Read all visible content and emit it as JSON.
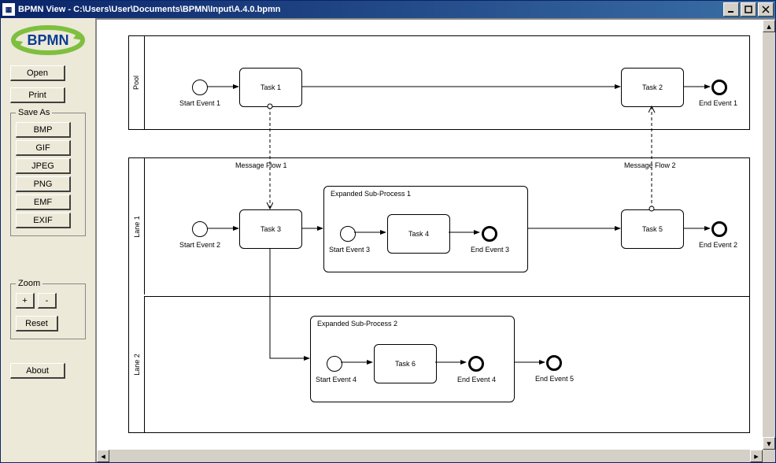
{
  "window": {
    "title": "BPMN View - C:\\Users\\User\\Documents\\BPMN\\Input\\A.4.0.bpmn"
  },
  "sidebar": {
    "open": "Open",
    "print": "Print",
    "save_as_legend": "Save As",
    "bmp": "BMP",
    "gif": "GIF",
    "jpeg": "JPEG",
    "png": "PNG",
    "emf": "EMF",
    "exif": "EXIF",
    "zoom_legend": "Zoom",
    "zoom_in": "+",
    "zoom_out": "-",
    "reset": "Reset",
    "about": "About"
  },
  "diagram": {
    "pool_label": "Pool",
    "lane1_label": "Lane 1",
    "lane2_label": "Lane 2",
    "start_event_1": "Start Event 1",
    "start_event_2": "Start Event 2",
    "start_event_3": "Start Event 3",
    "start_event_4": "Start Event 4",
    "end_event_1": "End Event 1",
    "end_event_2": "End Event 2",
    "end_event_3": "End Event 3",
    "end_event_4": "End Event 4",
    "end_event_5": "End Event 5",
    "task1": "Task 1",
    "task2": "Task 2",
    "task3": "Task 3",
    "task4": "Task 4",
    "task5": "Task 5",
    "task6": "Task 6",
    "subproc1": "Expanded Sub-Process 1",
    "subproc2": "Expanded Sub-Process 2",
    "msgflow1": "Message Flow 1",
    "msgflow2": "Message Flow 2"
  }
}
